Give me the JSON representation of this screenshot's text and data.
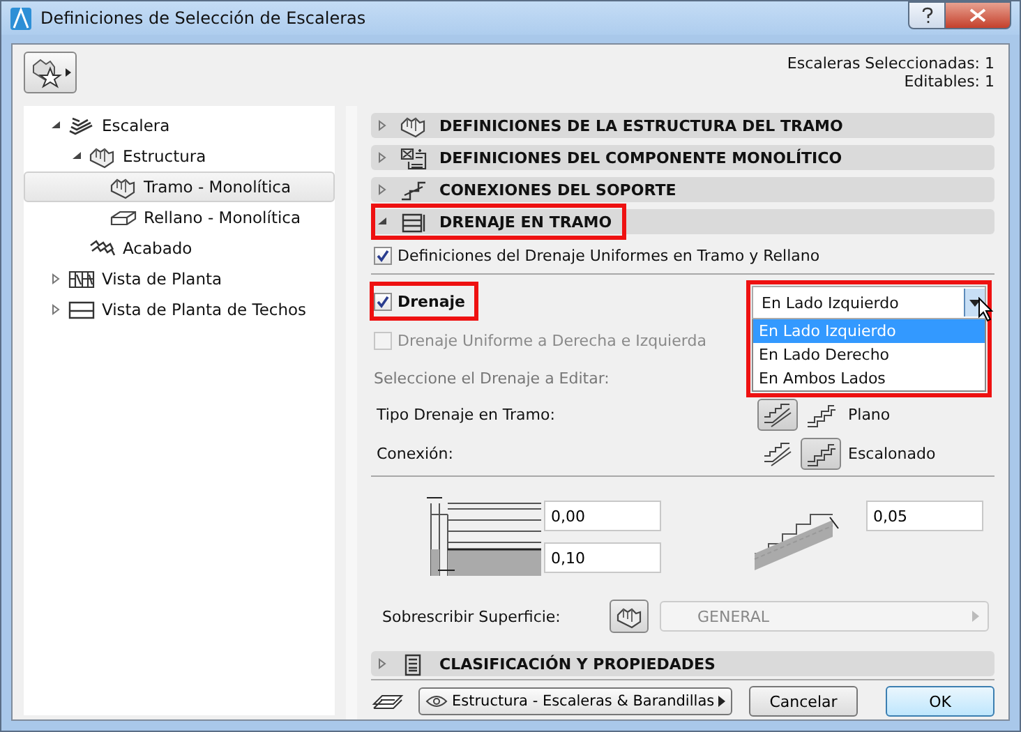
{
  "window": {
    "title": "Definiciones de Selección de Escaleras"
  },
  "selection_info": [
    "Escaleras Seleccionadas: 1",
    "Editables: 1"
  ],
  "tree": [
    {
      "label": "Escalera",
      "kind": "stair",
      "expanded": true,
      "selected": false,
      "children": [
        {
          "label": "Estructura",
          "kind": "structure",
          "expanded": true,
          "selected": false,
          "children": [
            {
              "label": "Tramo - Monolítica",
              "kind": "structure",
              "selected": true
            },
            {
              "label": "Rellano - Monolítica",
              "kind": "landing",
              "selected": false
            }
          ]
        },
        {
          "label": "Acabado",
          "kind": "finish",
          "selected": false
        }
      ]
    },
    {
      "label": "Vista de Planta",
      "kind": "plan",
      "expanded": false,
      "selected": false
    },
    {
      "label": "Vista de Planta de Techos",
      "kind": "ceiling",
      "expanded": false,
      "selected": false
    }
  ],
  "sections": [
    {
      "title": "DEFINICIONES DE LA ESTRUCTURA DEL TRAMO",
      "kind": "structure",
      "expanded": false,
      "highlighted": false
    },
    {
      "title": "DEFINICIONES DEL COMPONENTE MONOLÍTICO",
      "kind": "component",
      "expanded": false,
      "highlighted": false
    },
    {
      "title": "CONEXIONES DEL SOPORTE",
      "kind": "support",
      "expanded": false,
      "highlighted": false
    },
    {
      "title": "DRENAJE EN TRAMO",
      "kind": "drain",
      "expanded": true,
      "highlighted": true,
      "content": {
        "uniform": {
          "label": "Definiciones del Drenaje Uniformes en Tramo y Rellano",
          "checked": true
        },
        "drain": {
          "label": "Drenaje",
          "checked": true,
          "highlighted": true
        },
        "side": {
          "value": "En Lado Izquierdo",
          "expanded": true,
          "highlighted": true,
          "options": [
            {
              "label": "En Lado Izquierdo",
              "selected": true
            },
            {
              "label": "En Lado Derecho",
              "selected": false
            },
            {
              "label": "En Ambos Lados",
              "selected": false
            }
          ]
        },
        "uniform_sides": {
          "label": "Drenaje Uniforme a Derecha e Izquierda",
          "checked": false,
          "disabled": true
        },
        "edit_label": "Seleccione el Drenaje a Editar:",
        "type": {
          "label": "Tipo Drenaje en Tramo:",
          "options": [
            {
              "kind": "flat",
              "selected": true
            },
            {
              "kind": "stepped",
              "selected": false
            }
          ],
          "value": "Plano"
        },
        "connection": {
          "label": "Conexión:",
          "options": [
            {
              "kind": "flat",
              "selected": false
            },
            {
              "kind": "stepped",
              "selected": true
            }
          ],
          "value": "Escalonado"
        },
        "left_fields": [
          "0,00",
          "0,10"
        ],
        "right_field": "0,05",
        "surface": {
          "label": "Sobrescribir Superficie:",
          "value": "GENERAL",
          "disabled": true
        }
      }
    },
    {
      "title": "CLASIFICACIÓN Y PROPIEDADES",
      "kind": "list",
      "expanded": false,
      "highlighted": false
    }
  ],
  "footer": {
    "layer": "Estructura - Escaleras & Barandillas",
    "buttons": [
      {
        "label": "Cancelar",
        "default": false
      },
      {
        "label": "OK",
        "default": true
      }
    ]
  }
}
